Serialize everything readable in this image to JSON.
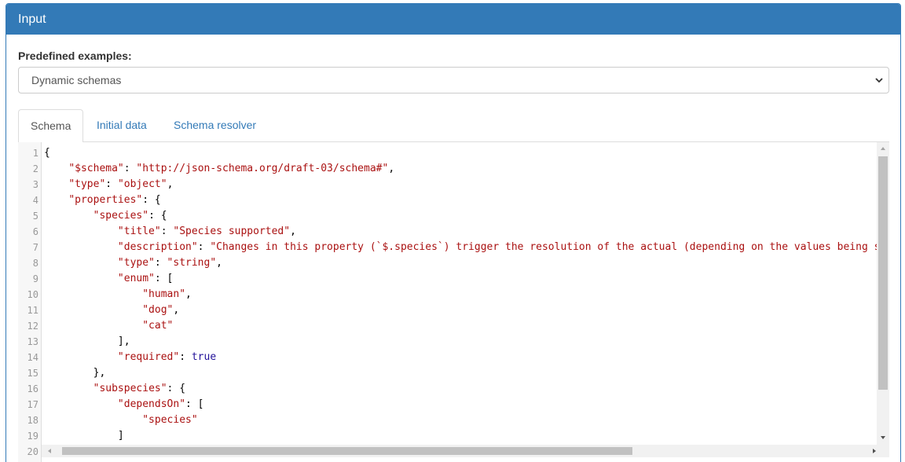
{
  "panel": {
    "title": "Input",
    "accent": "#337ab7"
  },
  "form": {
    "label": "Predefined examples:",
    "selected": "Dynamic schemas"
  },
  "tabs": [
    {
      "label": "Schema",
      "active": true
    },
    {
      "label": "Initial data",
      "active": false
    },
    {
      "label": "Schema resolver",
      "active": false
    }
  ],
  "editor": {
    "lines": [
      {
        "n": "1",
        "text": "{"
      },
      {
        "n": "2",
        "text": "    \"$schema\": \"http://json-schema.org/draft-03/schema#\","
      },
      {
        "n": "3",
        "text": "    \"type\": \"object\","
      },
      {
        "n": "4",
        "text": "    \"properties\": {"
      },
      {
        "n": "5",
        "text": "        \"species\": {"
      },
      {
        "n": "6",
        "text": "            \"title\": \"Species supported\","
      },
      {
        "n": "7",
        "text": "            \"description\": \"Changes in this property (`$.species`) trigger the resolution of the actual (depending on the values being sel"
      },
      {
        "n": "8",
        "text": "            \"type\": \"string\","
      },
      {
        "n": "9",
        "text": "            \"enum\": ["
      },
      {
        "n": "10",
        "text": "                \"human\","
      },
      {
        "n": "11",
        "text": "                \"dog\","
      },
      {
        "n": "12",
        "text": "                \"cat\""
      },
      {
        "n": "13",
        "text": "            ],"
      },
      {
        "n": "14",
        "text": "            \"required\": true"
      },
      {
        "n": "15",
        "text": "        },"
      },
      {
        "n": "16",
        "text": "        \"subspecies\": {"
      },
      {
        "n": "17",
        "text": "            \"dependsOn\": ["
      },
      {
        "n": "18",
        "text": "                \"species\""
      },
      {
        "n": "19",
        "text": "            ]"
      },
      {
        "n": "20",
        "text": ""
      }
    ]
  },
  "icons": {
    "select": "chevron-down-icon",
    "scroll_up": "arrow-up-icon",
    "scroll_down": "arrow-down-icon",
    "scroll_left": "arrow-left-icon",
    "scroll_right": "arrow-right-icon"
  }
}
